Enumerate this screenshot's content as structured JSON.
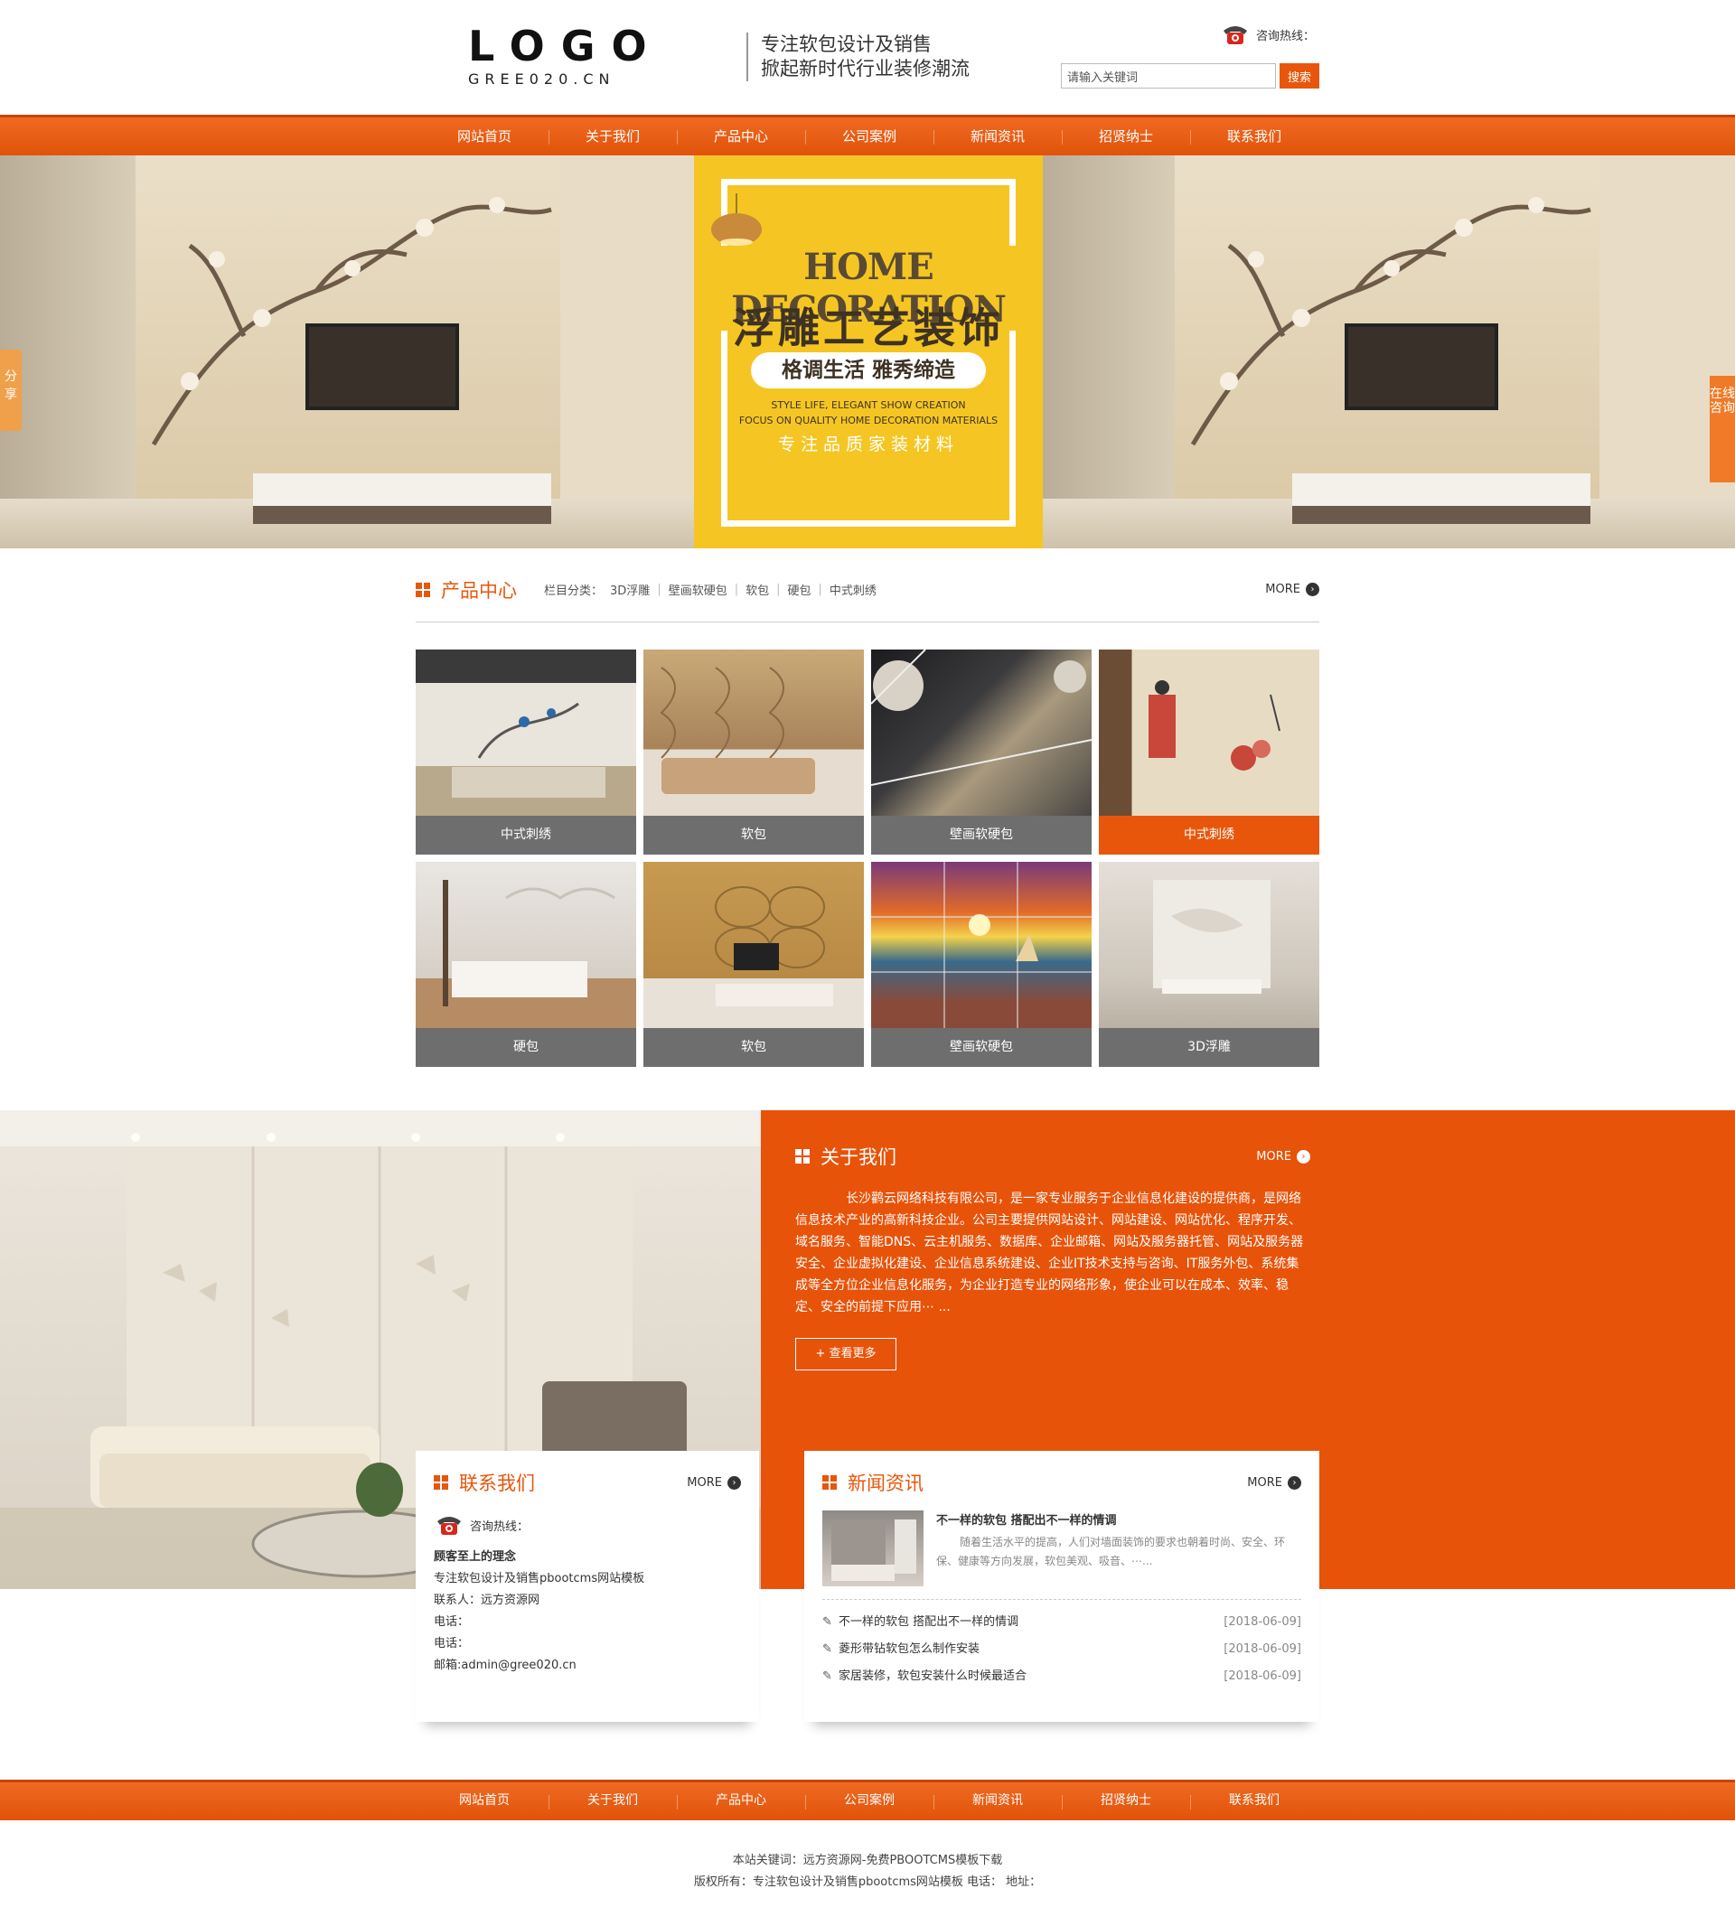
{
  "header": {
    "logo_main": "LOGO",
    "logo_sub": "GREE020.CN",
    "slogan_line1": "专注软包设计及销售",
    "slogan_line2": "掀起新时代行业装修潮流",
    "hotline_label": "咨询热线：",
    "search_placeholder": "请输入关键词",
    "search_button": "搜索"
  },
  "nav": [
    "网站首页",
    "关于我们",
    "产品中心",
    "公司案例",
    "新闻资讯",
    "招贤纳士",
    "联系我们"
  ],
  "side_tabs": {
    "left": "分享",
    "right": "在线咨询"
  },
  "banner": {
    "title_en": "HOME DECORATION",
    "title_cn": "浮雕工艺装饰",
    "pill": "格调生活 雅秀缔造",
    "en_line1": "STYLE LIFE, ELEGANT SHOW CREATION",
    "en_line2": "FOCUS ON QUALITY HOME DECORATION MATERIALS",
    "tagline": "专注品质家装材料"
  },
  "products_section": {
    "title": "产品中心",
    "category_label": "栏目分类：",
    "categories": [
      "3D浮雕",
      "壁画软硬包",
      "软包",
      "硬包",
      "中式刺绣"
    ],
    "more": "MORE",
    "items": [
      {
        "caption": "中式刺绣",
        "active": false
      },
      {
        "caption": "软包",
        "active": false
      },
      {
        "caption": "壁画软硬包",
        "active": false
      },
      {
        "caption": "中式刺绣",
        "active": true
      },
      {
        "caption": "硬包",
        "active": false
      },
      {
        "caption": "软包",
        "active": false
      },
      {
        "caption": "壁画软硬包",
        "active": false
      },
      {
        "caption": "3D浮雕",
        "active": false
      }
    ]
  },
  "about": {
    "title": "关于我们",
    "more": "MORE",
    "text": "长沙鹳云网络科技有限公司，是一家专业服务于企业信息化建设的提供商，是网络信息技术产业的高新科技企业。公司主要提供网站设计、网站建设、网站优化、程序开发、域名服务、智能DNS、云主机服务、数据库、企业邮箱、网站及服务器托管、网站及服务器安全、企业虚拟化建设、企业信息系统建设、企业IT技术支持与咨询、IT服务外包、系统集成等全方位企业信息化服务，为企业打造专业的网络形象，使企业可以在成本、效率、稳定、安全的前提下应用⋯ ...",
    "button": "+ 查看更多"
  },
  "contact": {
    "title": "联系我们",
    "more": "MORE",
    "hotline_label": "咨询热线：",
    "motto": "顾客至上的理念",
    "company": "专注软包设计及销售pbootcms网站模板",
    "contact_person": "联系人：远方资源网",
    "phone1": "电话：",
    "phone2": "电话：",
    "email": "邮箱:admin@gree020.cn"
  },
  "news": {
    "title": "新闻资讯",
    "more": "MORE",
    "featured_title": "不一样的软包 搭配出不一样的情调",
    "featured_desc": "随着生活水平的提高，人们对墙面装饰的要求也朝着时尚、安全、环保、健康等方向发展，软包美观、吸音、⋯...",
    "items": [
      {
        "title": "不一样的软包 搭配出不一样的情调",
        "date": "[2018-06-09]"
      },
      {
        "title": "菱形带钻软包怎么制作安装",
        "date": "[2018-06-09]"
      },
      {
        "title": "家居装修，软包安装什么时候最适合",
        "date": "[2018-06-09]"
      }
    ]
  },
  "footer": {
    "nav": [
      "网站首页",
      "关于我们",
      "产品中心",
      "公司案例",
      "新闻资讯",
      "招贤纳士",
      "联系我们"
    ],
    "keywords": "本站关键词：远方资源网-免费PBOOTCMS模板下载",
    "copyright": "版权所有：专注软包设计及销售pbootcms网站模板 电话： 地址："
  },
  "colors": {
    "accent": "#e8560c",
    "caption_gray": "#6e6e6e",
    "banner_yellow": "#f5c623"
  }
}
